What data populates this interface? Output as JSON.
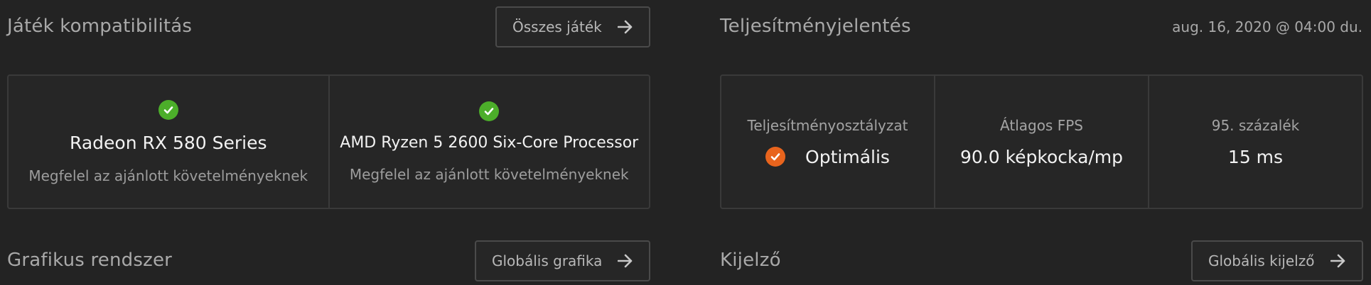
{
  "compatibility": {
    "title": "Játék kompatibilitás",
    "all_games_button": "Összes játék",
    "items": [
      {
        "name": "Radeon RX 580 Series",
        "status": "Megfelel az ajánlott követelményeknek",
        "status_color": "#4cae2a"
      },
      {
        "name": "AMD Ryzen 5 2600 Six-Core Processor",
        "status": "Megfelel az ajánlott követelményeknek",
        "status_color": "#4cae2a"
      }
    ]
  },
  "performance": {
    "title": "Teljesítményjelentés",
    "timestamp": "aug. 16, 2020 @ 04:00 du.",
    "metrics": [
      {
        "label": "Teljesítményosztályzat",
        "value": "Optimális",
        "indicator_color": "#e8641d"
      },
      {
        "label": "Átlagos FPS",
        "value": "90.0 képkocka/mp"
      },
      {
        "label": "95. százalék",
        "value": "15 ms"
      }
    ]
  },
  "graphics": {
    "title": "Grafikus rendszer",
    "button": "Globális grafika"
  },
  "display": {
    "title": "Kijelző",
    "button": "Globális kijelző"
  },
  "icons": {
    "check": "check-icon",
    "arrow": "arrow-right-icon"
  }
}
